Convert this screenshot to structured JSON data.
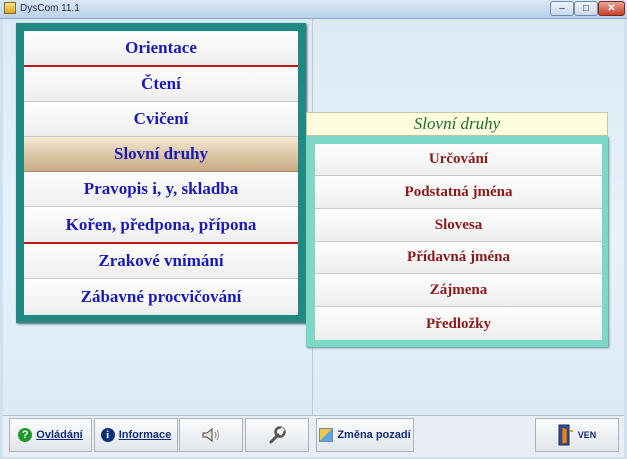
{
  "window": {
    "title": "DysCom 11.1",
    "min_glyph": "–",
    "max_glyph": "□",
    "close_glyph": "✕"
  },
  "main_menu": {
    "items": [
      {
        "label": "Orientace"
      },
      {
        "label": "Čtení"
      },
      {
        "label": "Cvičení"
      },
      {
        "label": "Slovní druhy"
      },
      {
        "label": "Pravopis i, y, skladba"
      },
      {
        "label": "Kořen, předpona, přípona"
      },
      {
        "label": "Zrakové vnímání"
      },
      {
        "label": "Zábavné procvičování"
      }
    ],
    "active_item": "Slovní druhy"
  },
  "submenu": {
    "title": "Slovní druhy",
    "items": [
      {
        "label": "Určování"
      },
      {
        "label": "Podstatná jména"
      },
      {
        "label": "Slovesa"
      },
      {
        "label": "Přídavná jména"
      },
      {
        "label": "Zájmena"
      },
      {
        "label": "Předložky"
      }
    ]
  },
  "toolbar": {
    "ovladani": {
      "label": "Ovládání",
      "icon": "question-icon",
      "icon_glyph": "?"
    },
    "informace": {
      "label": "Informace",
      "icon": "info-icon",
      "icon_glyph": "i"
    },
    "sound": {
      "icon": "speaker-icon"
    },
    "settings": {
      "icon": "wrench-icon"
    },
    "zmena_pozadi": {
      "label": "Změna pozadí",
      "icon": "background-icon"
    },
    "exit": {
      "label": "VEN",
      "icon": "exit-door-icon"
    }
  },
  "colors": {
    "main_menu_frame": "#1f8a84",
    "submenu_frame": "#7ed8c8",
    "main_text": "#1a1ab8",
    "sub_text": "#8a1a1a",
    "submenu_title_text": "#1a6e2e",
    "separator_red": "#c01818"
  }
}
